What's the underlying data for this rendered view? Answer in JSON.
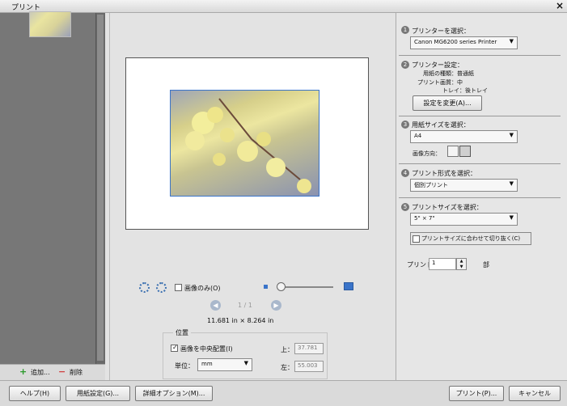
{
  "window": {
    "title": "プリント",
    "close_icon": "×"
  },
  "thumbnails": {
    "add_label": "追加...",
    "remove_label": "削除"
  },
  "preview": {
    "image_only_label": "画像のみ(O)",
    "page_indicator": "1 / 1",
    "paper_size_text": "11.681 in × 8.264 in"
  },
  "position": {
    "title": "位置",
    "center_label": "画像を中央配置(I)",
    "top_label": "上：",
    "top_value": "37.781",
    "left_label": "左：",
    "left_value": "55.003",
    "unit_label": "単位：",
    "unit_value": "mm"
  },
  "steps": {
    "printer": {
      "num": "1",
      "label": "プリンターを選択：",
      "value": "Canon MG6200 series Printer"
    },
    "printer_settings": {
      "num": "2",
      "label": "プリンター設定：",
      "paper_type": "用紙の種類：普通紙",
      "print_quality": "プリント画質：中",
      "tray": "トレイ：後トレイ",
      "change_button": "設定を変更(A)..."
    },
    "paper_size": {
      "num": "3",
      "label": "用紙サイズを選択：",
      "value": "A4",
      "orientation_label": "画像方向："
    },
    "print_type": {
      "num": "4",
      "label": "プリント形式を選択：",
      "value": "個別プリント"
    },
    "print_size": {
      "num": "5",
      "label": "プリントサイズを選択：",
      "value": "5\" × 7\"",
      "crop_label": "プリントサイズに合わせて切り抜く(C)"
    }
  },
  "copies": {
    "label": "プリント",
    "value": "1",
    "unit": "部"
  },
  "footer": {
    "help_button": "ヘルプ(H)",
    "page_setup_button": "用紙設定(G)...",
    "more_options_button": "詳細オプション(M)...",
    "print_button": "プリント(P)...",
    "cancel_button": "キャンセル"
  },
  "colors": {
    "accent": "#3a74c9",
    "step_circle": "#777777"
  }
}
